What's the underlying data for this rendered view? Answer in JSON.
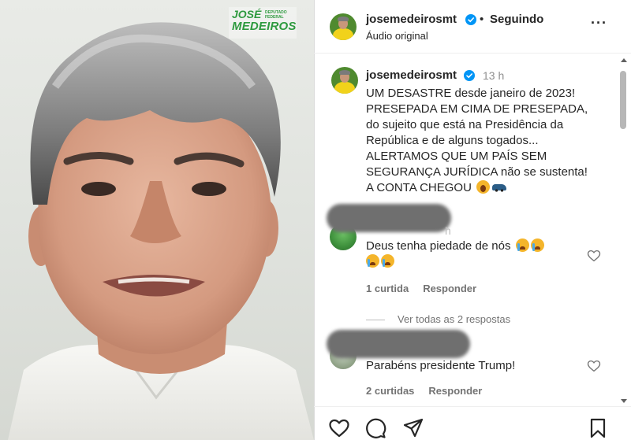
{
  "video": {
    "brand_first": "JOSÉ",
    "brand_last": "MEDEIROS",
    "brand_tagline": "DEPUTADO FEDERAL"
  },
  "header": {
    "username": "josemedeirosmt",
    "separator": "•",
    "follow_status": "Seguindo",
    "audio": "Áudio original",
    "more_icon": "more-horizontal-icon"
  },
  "caption": {
    "username": "josemedeirosmt",
    "time": "13 h",
    "text": "UM DESASTRE desde janeiro de 2023!\nPRESEPADA EM CIMA DE PRESEPADA,\ndo sujeito que está na Presidência da\nRepública e de alguns togados...\nALERTAMOS QUE UM PAÍS SEM\nSEGURANÇA JURÍDICA não se sustenta!\nA CONTA CHEGOU",
    "emojis": [
      "face-screaming-emoji",
      "car-emoji"
    ]
  },
  "comments": [
    {
      "handle_tail": "h",
      "text": "Deus tenha piedade de nós",
      "emojis": [
        "crying-face-emoji",
        "crying-face-emoji",
        "crying-face-emoji",
        "crying-face-emoji"
      ],
      "likes": "1 curtida",
      "reply": "Responder"
    },
    {
      "text": "Parabéns presidente Trump!",
      "likes": "2 curtidas",
      "reply": "Responder"
    }
  ],
  "view_replies": "Ver todas as 2 respostas",
  "actions": [
    "heart-icon",
    "comment-icon",
    "share-icon",
    "save-icon"
  ],
  "colors": {
    "verified": "#0095f6",
    "brand_green": "#2e9a3f",
    "muted_text": "#737373"
  }
}
